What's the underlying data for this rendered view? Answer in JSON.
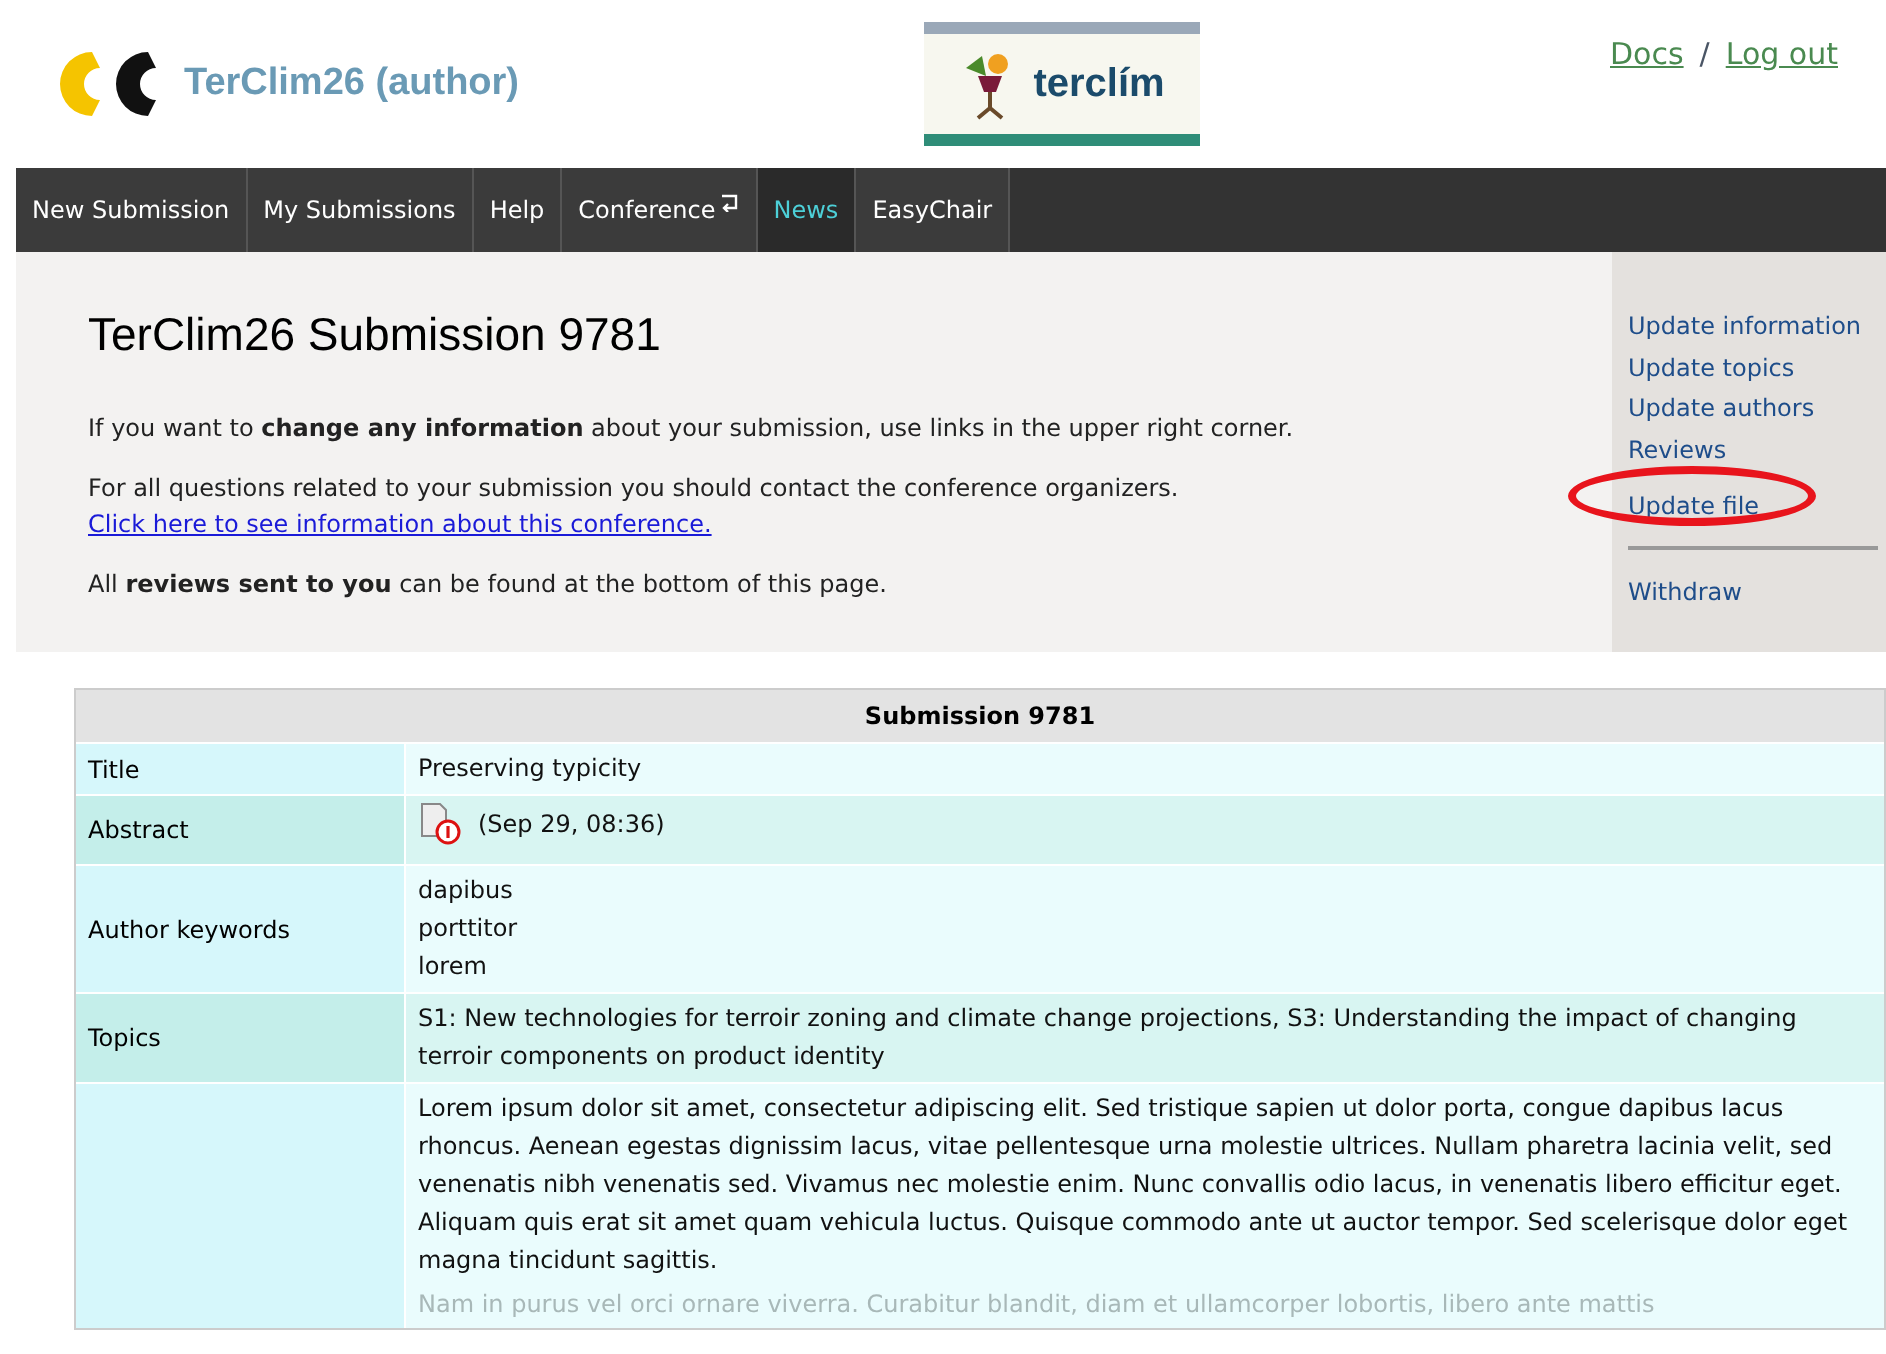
{
  "header": {
    "logo_text": "TerClim26 (author)",
    "banner_text": "terclím",
    "links": [
      {
        "label": "Docs"
      },
      {
        "label": "Log out"
      }
    ],
    "separator": "/"
  },
  "nav": [
    {
      "label": "New Submission",
      "selected": false,
      "kind": "plain"
    },
    {
      "label": "My Submissions",
      "selected": false,
      "kind": "plain"
    },
    {
      "label": "Help",
      "selected": false,
      "kind": "plain"
    },
    {
      "label": "Conference",
      "selected": false,
      "kind": "return"
    },
    {
      "label": "News",
      "selected": true,
      "kind": "plain"
    },
    {
      "label": "EasyChair",
      "selected": false,
      "kind": "plain"
    }
  ],
  "page_title": "TerClim26 Submission 9781",
  "paragraphs": [
    {
      "text": "If you want to **change any information** about your submission, use links in the upper right corner."
    },
    {
      "text": "For all questions related to your submission you should contact the conference organizers.",
      "link": "Click here to see information about this conference."
    },
    {
      "text": "All **reviews sent to you** can be found at the bottom of this page."
    }
  ],
  "side_links": [
    {
      "label": "Update information",
      "circled": false
    },
    {
      "label": "Update topics",
      "circled": false
    },
    {
      "label": "Update authors",
      "circled": false
    },
    {
      "label": "Reviews",
      "circled": false
    },
    {
      "label": "Update file",
      "circled": true
    }
  ],
  "side_bottom_link": "Withdraw",
  "table": {
    "title": "Submission 9781",
    "rows": [
      {
        "label": "Title",
        "kind": "text",
        "lines": [
          "Preserving typicity"
        ]
      },
      {
        "label": "Abstract",
        "kind": "file",
        "lines": [
          "(Sep 29, 08:36)"
        ]
      },
      {
        "label": "Author keywords",
        "kind": "text",
        "lines": [
          "dapibus",
          "porttitor",
          "lorem"
        ]
      },
      {
        "label": "Topics",
        "kind": "text",
        "lines": [
          "S1: New technologies for terroir zoning and climate change projections, S3: Understanding the impact of changing terroir components on product identity"
        ]
      },
      {
        "label": "",
        "kind": "text",
        "lines": [
          "Lorem ipsum dolor sit amet, consectetur adipiscing elit. Sed tristique sapien ut dolor porta, congue dapibus lacus rhoncus. Aenean egestas dignissim lacus, vitae pellentesque urna molestie ultrices. Nullam pharetra lacinia velit, sed venenatis nibh venenatis sed. Vivamus nec molestie enim. Nunc convallis odio lacus, in venenatis libero efficitur eget. Aliquam quis erat sit amet quam vehicula luctus. Quisque commodo ante ut auctor tempor. Sed scelerisque dolor eget magna tincidunt sagittis."
        ],
        "faded": "Nam in purus vel orci ornare viverra. Curabitur blandit, diam et ullamcorper lobortis, libero ante mattis"
      }
    ]
  }
}
